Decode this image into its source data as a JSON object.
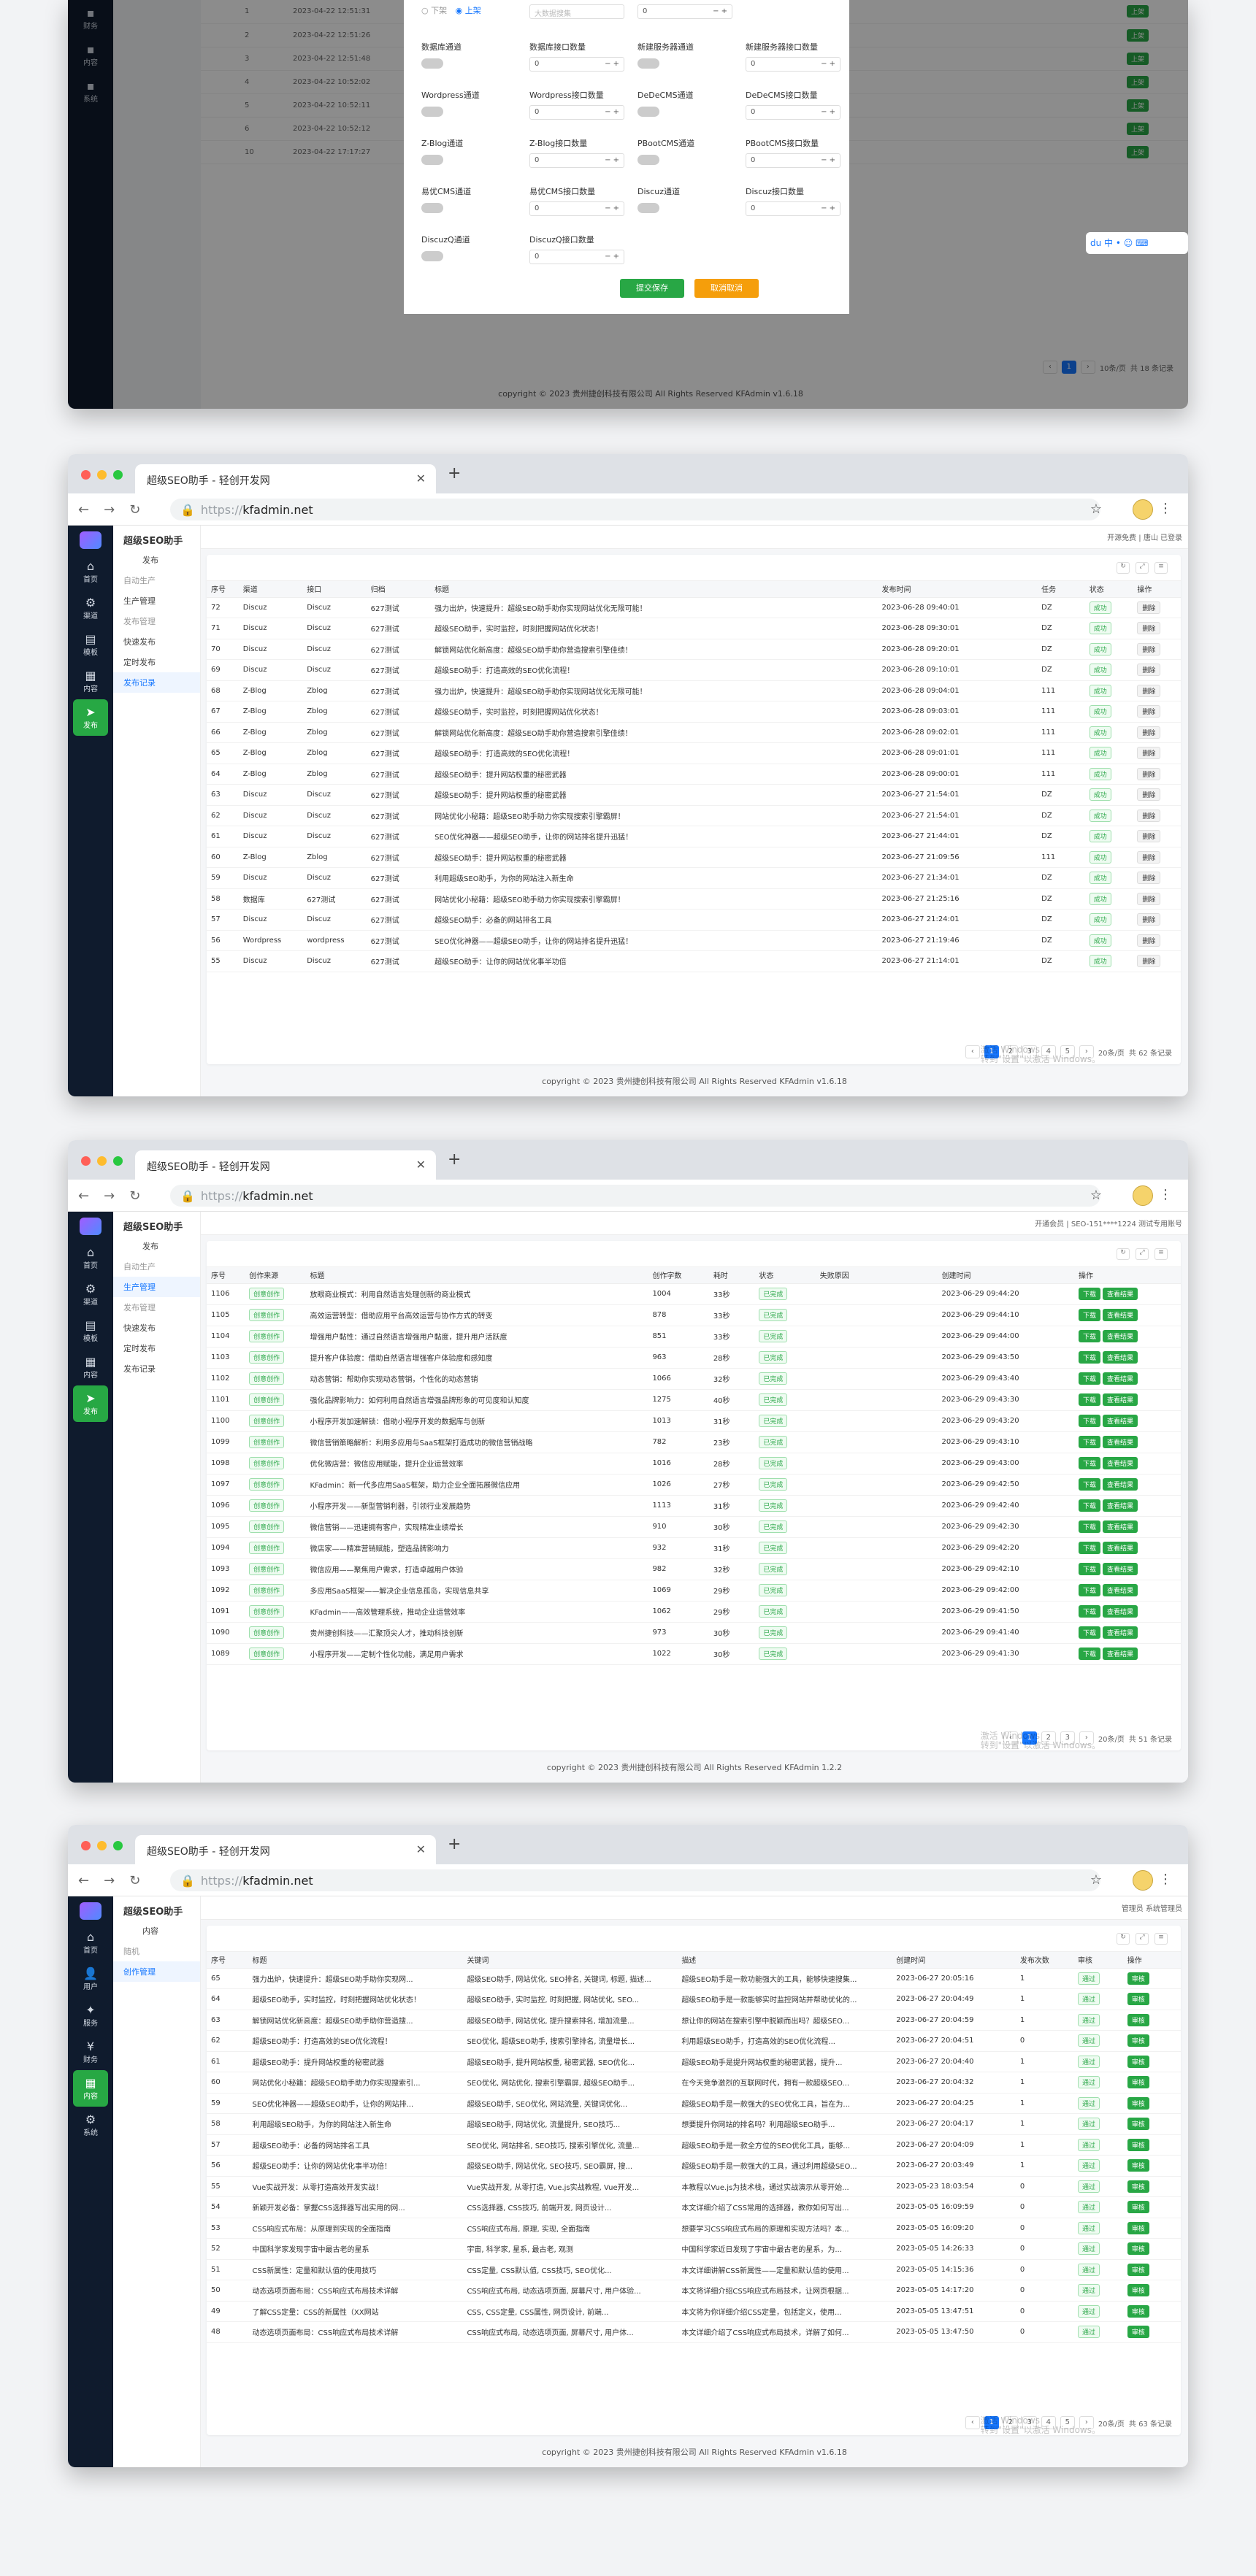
{
  "browser": {
    "tab_title": "超级SEO助手 - 轻创开发网",
    "url_proto": "https://",
    "url_host": "kfadmin.net"
  },
  "shot1": {
    "nav": [
      {
        "label": "财务"
      },
      {
        "label": "内容"
      },
      {
        "label": "系统"
      }
    ],
    "bg_rows": [
      [
        "1",
        "2023-04-22 12:51:31"
      ],
      [
        "2",
        "2023-04-22 12:51:26"
      ],
      [
        "3",
        "2023-04-22 12:51:48"
      ],
      [
        "4",
        "2023-04-22 10:52:02"
      ],
      [
        "5",
        "2023-04-22 10:52:11"
      ],
      [
        "6",
        "2023-04-22 10:52:12"
      ],
      [
        "10",
        "2023-04-22 17:17:27"
      ]
    ],
    "bg_action": "上架",
    "modal": {
      "top": {
        "off": "下架",
        "on": "上架",
        "placeholder": "大数据搜集"
      },
      "rows": [
        [
          "数据库通道",
          "数据库接口数量",
          "新建服务器通道",
          "新建服务器接口数量"
        ],
        [
          "Wordpress通道",
          "Wordpress接口数量",
          "DeDeCMS通道",
          "DeDeCMS接口数量"
        ],
        [
          "Z-Blog通道",
          "Z-Blog接口数量",
          "PBootCMS通道",
          "PBootCMS接口数量"
        ],
        [
          "易优CMS通道",
          "易优CMS接口数量",
          "Discuz通道",
          "Discuz接口数量"
        ],
        [
          "DiscuzQ通道",
          "DiscuzQ接口数量",
          "",
          ""
        ]
      ],
      "num": "0",
      "save": "提交保存",
      "cancel": "取消取消"
    },
    "pager_total": "共 18 条记录",
    "pager_size": "10条/页",
    "footer": "copyright © 2023 贵州捷创科技有限公司 All Rights Reserved KFAdmin v1.6.18"
  },
  "shot2": {
    "nav": [
      {
        "label": "首页",
        "icon": "home-icon"
      },
      {
        "label": "渠道",
        "icon": "channel-icon"
      },
      {
        "label": "模板",
        "icon": "template-icon"
      },
      {
        "label": "内容",
        "icon": "content-icon"
      },
      {
        "label": "发布",
        "icon": "publish-icon"
      }
    ],
    "sub_title": "超级SEO助手",
    "sub": [
      {
        "label": "发布",
        "grey": false,
        "ind": true
      },
      {
        "label": "自动生产",
        "grey": true
      },
      {
        "label": "生产管理",
        "grey": false
      },
      {
        "label": "发布管理",
        "grey": true
      },
      {
        "label": "快速发布",
        "grey": false
      },
      {
        "label": "定时发布",
        "grey": false
      },
      {
        "label": "发布记录",
        "grey": false,
        "active": true
      }
    ],
    "top_right": "开源免费 | 唐山 已登录",
    "headers": [
      "序号",
      "渠道",
      "接口",
      "归档",
      "标题",
      "发布时间",
      "任务",
      "状态",
      "操作"
    ],
    "rows": [
      [
        "72",
        "Discuz",
        "Discuz",
        "627测试",
        "强力出炉，快速提升：超级SEO助手助你实现网站优化无限可能！",
        "2023-06-28 09:40:01",
        "DZ"
      ],
      [
        "71",
        "Discuz",
        "Discuz",
        "627测试",
        "超级SEO助手，实时监控，时刻把握网站优化状态！",
        "2023-06-28 09:30:01",
        "DZ"
      ],
      [
        "70",
        "Discuz",
        "Discuz",
        "627测试",
        "解锁网站优化新高度：超级SEO助手助你营造搜索引擎佳绩！",
        "2023-06-28 09:20:01",
        "DZ"
      ],
      [
        "69",
        "Discuz",
        "Discuz",
        "627测试",
        "超级SEO助手：打造高效的SEO优化流程！",
        "2023-06-28 09:10:01",
        "DZ"
      ],
      [
        "68",
        "Z-Blog",
        "Zblog",
        "627测试",
        "强力出炉，快速提升：超级SEO助手助你实现网站优化无限可能！",
        "2023-06-28 09:04:01",
        "111"
      ],
      [
        "67",
        "Z-Blog",
        "Zblog",
        "627测试",
        "超级SEO助手，实时监控，时刻把握网站优化状态！",
        "2023-06-28 09:03:01",
        "111"
      ],
      [
        "66",
        "Z-Blog",
        "Zblog",
        "627测试",
        "解锁网站优化新高度：超级SEO助手助你营造搜索引擎佳绩！",
        "2023-06-28 09:02:01",
        "111"
      ],
      [
        "65",
        "Z-Blog",
        "Zblog",
        "627测试",
        "超级SEO助手：打造高效的SEO优化流程！",
        "2023-06-28 09:01:01",
        "111"
      ],
      [
        "64",
        "Z-Blog",
        "Zblog",
        "627测试",
        "超级SEO助手：提升网站权重的秘密武器",
        "2023-06-28 09:00:01",
        "111"
      ],
      [
        "63",
        "Discuz",
        "Discuz",
        "627测试",
        "超级SEO助手：提升网站权重的秘密武器",
        "2023-06-27 21:54:01",
        "DZ"
      ],
      [
        "62",
        "Discuz",
        "Discuz",
        "627测试",
        "网站优化小秘籍：超级SEO助手助力你实现搜索引擎霸屏！",
        "2023-06-27 21:54:01",
        "DZ"
      ],
      [
        "61",
        "Discuz",
        "Discuz",
        "627测试",
        "SEO优化神器——超级SEO助手，让你的网站排名提升迅猛！",
        "2023-06-27 21:44:01",
        "DZ"
      ],
      [
        "60",
        "Z-Blog",
        "Zblog",
        "627测试",
        "超级SEO助手：提升网站权重的秘密武器",
        "2023-06-27 21:09:56",
        "111"
      ],
      [
        "59",
        "Discuz",
        "Discuz",
        "627测试",
        "利用超级SEO助手，为你的网站注入新生命",
        "2023-06-27 21:34:01",
        "DZ"
      ],
      [
        "58",
        "数据库",
        "627测试",
        "627测试",
        "网站优化小秘籍：超级SEO助手助力你实现搜索引擎霸屏！",
        "2023-06-27 21:25:16",
        "DZ"
      ],
      [
        "57",
        "Discuz",
        "Discuz",
        "627测试",
        "超级SEO助手：必备的网站排名工具",
        "2023-06-27 21:24:01",
        "DZ"
      ],
      [
        "56",
        "Wordpress",
        "wordpress",
        "627测试",
        "SEO优化神器——超级SEO助手，让你的网站排名提升迅猛！",
        "2023-06-27 21:19:46",
        "DZ"
      ],
      [
        "55",
        "Discuz",
        "Discuz",
        "627测试",
        "超级SEO助手：让你的网站优化事半功倍",
        "2023-06-27 21:14:01",
        "DZ"
      ]
    ],
    "status": "成功",
    "op": "删除",
    "pages": [
      "1",
      "2",
      "3",
      "4",
      "5"
    ],
    "pager_total": "共 62 条记录",
    "pager_size": "20条/页",
    "watermark": "激活 Windows\n转到\"设置\"以激活 Windows。",
    "footer": "copyright © 2023 贵州捷创科技有限公司 All Rights Reserved KFAdmin v1.6.18"
  },
  "shot3": {
    "nav": [
      {
        "label": "首页",
        "icon": "home-icon"
      },
      {
        "label": "渠道",
        "icon": "channel-icon"
      },
      {
        "label": "模板",
        "icon": "template-icon"
      },
      {
        "label": "内容",
        "icon": "content-icon"
      },
      {
        "label": "发布",
        "icon": "publish-icon"
      }
    ],
    "sub_title": "超级SEO助手",
    "sub": [
      {
        "label": "发布",
        "grey": false,
        "ind": true
      },
      {
        "label": "自动生产",
        "grey": true
      },
      {
        "label": "生产管理",
        "grey": false,
        "active": true
      },
      {
        "label": "发布管理",
        "grey": true
      },
      {
        "label": "快速发布",
        "grey": false
      },
      {
        "label": "定时发布",
        "grey": false
      },
      {
        "label": "发布记录",
        "grey": false
      }
    ],
    "top_right": "开通会员 | SEO-151****1224 测试专用账号",
    "headers": [
      "序号",
      "创作来源",
      "标题",
      "创作字数",
      "耗时",
      "状态",
      "失败原因",
      "创建时间",
      "操作"
    ],
    "rows": [
      [
        "1106",
        "创意创作",
        "放眼商业模式：利用自然语言处理创新的商业模式",
        "1004",
        "33秒",
        "2023-06-29 09:44:20"
      ],
      [
        "1105",
        "创意创作",
        "高效运营转型：借助应用平台高效运营与协作方式的转变",
        "878",
        "33秒",
        "2023-06-29 09:44:10"
      ],
      [
        "1104",
        "创意创作",
        "增强用户黏性：通过自然语言增强用户黏度，提升用户活跃度",
        "851",
        "33秒",
        "2023-06-29 09:44:00"
      ],
      [
        "1103",
        "创意创作",
        "提升客户体验度：借助自然语言增强客户体验度和感知度",
        "963",
        "28秒",
        "2023-06-29 09:43:50"
      ],
      [
        "1102",
        "创意创作",
        "动态营销：帮助你实现动态营销，个性化的动态营销",
        "1066",
        "32秒",
        "2023-06-29 09:43:40"
      ],
      [
        "1101",
        "创意创作",
        "强化品牌影响力：如何利用自然语言增强品牌形象的可见度和认知度",
        "1275",
        "40秒",
        "2023-06-29 09:43:30"
      ],
      [
        "1100",
        "创意创作",
        "小程序开发加速解锁：借助小程序开发的数据库与创新",
        "1013",
        "31秒",
        "2023-06-29 09:43:20"
      ],
      [
        "1099",
        "创意创作",
        "微信营销策略解析：利用多应用与SaaS框架打造成功的微信营销战略",
        "782",
        "23秒",
        "2023-06-29 09:43:10"
      ],
      [
        "1098",
        "创意创作",
        "优化微店营：微信应用赋能，提升企业运营效率",
        "1016",
        "28秒",
        "2023-06-29 09:43:00"
      ],
      [
        "1097",
        "创意创作",
        "KFadmin：新一代多应用SaaS框架，助力企业全面拓展微信应用",
        "1026",
        "27秒",
        "2023-06-29 09:42:50"
      ],
      [
        "1096",
        "创意创作",
        "小程序开发——新型营销利器，引领行业发展趋势",
        "1113",
        "31秒",
        "2023-06-29 09:42:40"
      ],
      [
        "1095",
        "创意创作",
        "微信营销——迅速拥有客户，实现精准业绩增长",
        "910",
        "30秒",
        "2023-06-29 09:42:30"
      ],
      [
        "1094",
        "创意创作",
        "微店家——精准营销赋能，塑造品牌影响力",
        "932",
        "31秒",
        "2023-06-29 09:42:20"
      ],
      [
        "1093",
        "创意创作",
        "微信应用——聚焦用户需求，打造卓越用户体验",
        "982",
        "32秒",
        "2023-06-29 09:42:10"
      ],
      [
        "1092",
        "创意创作",
        "多应用SaaS框架——解决企业信息孤岛，实现信息共享",
        "1069",
        "29秒",
        "2023-06-29 09:42:00"
      ],
      [
        "1091",
        "创意创作",
        "KFadmin——高效管理系统，推动企业运营效率",
        "1062",
        "29秒",
        "2023-06-29 09:41:50"
      ],
      [
        "1090",
        "创意创作",
        "贵州捷创科技——汇聚顶尖人才，推动科技创新",
        "973",
        "30秒",
        "2023-06-29 09:41:40"
      ],
      [
        "1089",
        "创意创作",
        "小程序开发——定制个性化功能，满足用户需求",
        "1022",
        "30秒",
        "2023-06-29 09:41:30"
      ]
    ],
    "status": "已完成",
    "op1": "下载",
    "op2": "查看结果",
    "pages": [
      "1",
      "2",
      "3"
    ],
    "pager_total": "共 51 条记录",
    "pager_size": "20条/页",
    "watermark": "激活 Windows\n转到\"设置\"以激活 Windows。",
    "footer": "copyright © 2023 贵州捷创科技有限公司 All Rights Reserved KFAdmin 1.2.2"
  },
  "shot4": {
    "nav": [
      {
        "label": "首页",
        "icon": "home-icon"
      },
      {
        "label": "用户",
        "icon": "user-icon"
      },
      {
        "label": "服务",
        "icon": "service-icon"
      },
      {
        "label": "财务",
        "icon": "finance-icon"
      },
      {
        "label": "内容",
        "icon": "content-icon"
      },
      {
        "label": "系统",
        "icon": "gear-icon"
      }
    ],
    "sub_title": "超级SEO助手",
    "sub": [
      {
        "label": "内容",
        "grey": false,
        "ind": true
      },
      {
        "label": "随机",
        "grey": true
      },
      {
        "label": "创作管理",
        "grey": false,
        "active": true
      }
    ],
    "top_right": "管理员 系统管理员",
    "headers": [
      "序号",
      "标题",
      "关键词",
      "描述",
      "创建时间",
      "发布次数",
      "审核",
      "操作"
    ],
    "rows": [
      [
        "65",
        "强力出炉，快速提升：超级SEO助手助你实现网...",
        "超级SEO助手, 网站优化, SEO排名, 关键词, 标题, 描述...",
        "超级SEO助手是一款功能强大的工具，能够快速搜集...",
        "2023-06-27 20:05:16",
        "1"
      ],
      [
        "64",
        "超级SEO助手，实时监控，时刻把握网站优化状态！",
        "超级SEO助手, 实时监控, 时刻把握, 网站优化, SEO...",
        "超级SEO助手是一款能够实时监控网站并帮助优化的...",
        "2023-06-27 20:04:49",
        "1"
      ],
      [
        "63",
        "解锁网站优化新高度：超级SEO助手助你营造搜...",
        "超级SEO助手, 网站优化, 提升搜索排名, 增加流量...",
        "想让你的网站在搜索引擎中脱颖而出吗？超级SEO...",
        "2023-06-27 20:04:59",
        "1"
      ],
      [
        "62",
        "超级SEO助手：打造高效的SEO优化流程！",
        "SEO优化, 超级SEO助手, 搜索引擎排名, 流量增长...",
        "利用超级SEO助手，打造高效的SEO优化流程...",
        "2023-06-27 20:04:51",
        "0"
      ],
      [
        "61",
        "超级SEO助手：提升网站权重的秘密武器",
        "超级SEO助手, 提升网站权重, 秘密武器, SEO优化...",
        "超级SEO助手是提升网站权重的秘密武器，提升...",
        "2023-06-27 20:04:40",
        "1"
      ],
      [
        "60",
        "网站优化小秘籍：超级SEO助手助力你实现搜索引...",
        "SEO优化, 网站优化, 搜索引擎霸屏, 超级SEO助手...",
        "在今天竞争激烈的互联网时代，拥有一款超级SEO...",
        "2023-06-27 20:04:32",
        "1"
      ],
      [
        "59",
        "SEO优化神器——超级SEO助手，让你的网站排...",
        "超级SEO助手, SEO优化, 网站流量, 关键词优化...",
        "超级SEO助手是一款强大的SEO优化工具，旨在为...",
        "2023-06-27 20:04:25",
        "1"
      ],
      [
        "58",
        "利用超级SEO助手，为你的网站注入新生命",
        "超级SEO助手, 网站优化, 流量提升, SEO技巧...",
        "想要提升你网站的排名吗？利用超级SEO助手...",
        "2023-06-27 20:04:17",
        "1"
      ],
      [
        "57",
        "超级SEO助手：必备的网站排名工具",
        "SEO优化, 网站排名, SEO技巧, 搜索引擎优化, 流量...",
        "超级SEO助手是一款全方位的SEO优化工具，能够...",
        "2023-06-27 20:04:09",
        "1"
      ],
      [
        "56",
        "超级SEO助手：让你的网站优化事半功倍！",
        "超级SEO助手, 网站优化, SEO技巧, SEO霸屏, 搜...",
        "超级SEO助手是一款强大的工具，通过利用超级SEO...",
        "2023-06-27 20:03:49",
        "1"
      ],
      [
        "55",
        "Vue实战开发：从零打造高效开发实战！",
        "Vue实战开发, 从零打造, Vue.js实战教程, Vue开发...",
        "本教程以Vue.js为技术栈，通过实战演示从零开始...",
        "2023-05-23 18:03:54",
        "0"
      ],
      [
        "54",
        "新颖开发必备：掌握CSS选择器写出实用的网...",
        "CSS选择器, CSS技巧, 前端开发, 网页设计...",
        "本文详细介绍了CSS常用的选择器，教你如何写出...",
        "2023-05-05 16:09:59",
        "0"
      ],
      [
        "53",
        "CSS响应式布局：从原理到实现的全面指南",
        "CSS响应式布局, 原理, 实现, 全面指南",
        "想要学习CSS响应式布局的原理和实现方法吗？本...",
        "2023-05-05 16:09:20",
        "0"
      ],
      [
        "52",
        "中国科学家发现宇宙中最古老的星系",
        "宇宙, 科学家, 星系, 最古老, 观测",
        "中国科学家近日发现了宇宙中最古老的星系，为...",
        "2023-05-05 14:26:33",
        "0"
      ],
      [
        "51",
        "CSS新属性：定量和默认值的使用技巧",
        "CSS定量, CSS默认值, CSS技巧, SEO优化...",
        "本文详细讲解CSS新属性——定量和默认值的使用...",
        "2023-05-05 14:15:36",
        "0"
      ],
      [
        "50",
        "动态选项页面布局：CSS响应式布局技术详解",
        "CSS响应式布局, 动态选项页面, 屏幕尺寸, 用户体验...",
        "本文将详细介绍CSS响应式布局技术，让网页根据...",
        "2023-05-05 14:17:20",
        "0"
      ],
      [
        "49",
        "了解CSS定量：CSS的新属性（XX网站",
        "CSS, CSS定量, CSS属性, 网页设计, 前端...",
        "本文将为你详细介绍CSS定量，包括定义，使用...",
        "2023-05-05 13:47:51",
        "0"
      ],
      [
        "48",
        "动态选项页面布局：CSS响应式布局技术详解",
        "CSS响应式布局, 动态选项页面, 屏幕尺寸, 用户体...",
        "本文详细介绍了CSS响应式布局技术，详解了如何...",
        "2023-05-05 13:47:50",
        "0"
      ]
    ],
    "audit": "通过",
    "op": "审核",
    "pages": [
      "1",
      "2",
      "3",
      "4",
      "5"
    ],
    "pager_total": "共 63 条记录",
    "pager_size": "20条/页",
    "watermark": "激活 Windows\n转到\"设置\"以激活 Windows。",
    "footer": "copyright © 2023 贵州捷创科技有限公司 All Rights Reserved KFAdmin v1.6.18"
  },
  "colors": {
    "green": "#28a745",
    "blue": "#1677ff",
    "nav": "#0f1b2d",
    "orange": "#f59e0b"
  }
}
